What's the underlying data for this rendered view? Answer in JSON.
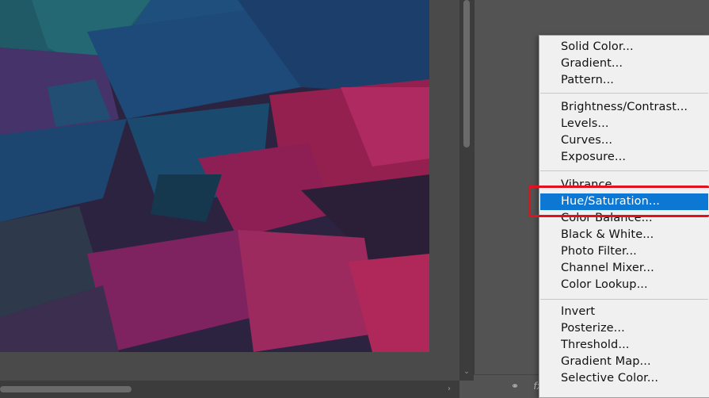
{
  "canvas": {
    "colors": {
      "blue": "#1f4f7d",
      "teal": "#1d5a6a",
      "magenta": "#a0215e",
      "purple": "#4b2a6b",
      "dark": "#1a1a2e"
    }
  },
  "menu": {
    "groups": [
      [
        "Solid Color...",
        "Gradient...",
        "Pattern..."
      ],
      [
        "Brightness/Contrast...",
        "Levels...",
        "Curves...",
        "Exposure..."
      ],
      [
        "Vibrance...",
        "Hue/Saturation...",
        "Color Balance...",
        "Black & White...",
        "Photo Filter...",
        "Channel Mixer...",
        "Color Lookup..."
      ],
      [
        "Invert",
        "Posterize...",
        "Threshold...",
        "Gradient Map...",
        "Selective Color..."
      ]
    ],
    "selected": "Hue/Saturation...",
    "highlight_color": "#e3101e",
    "selection_color": "#0d78d4"
  },
  "footer": {
    "icons": [
      "link-icon",
      "fx-icon"
    ]
  }
}
